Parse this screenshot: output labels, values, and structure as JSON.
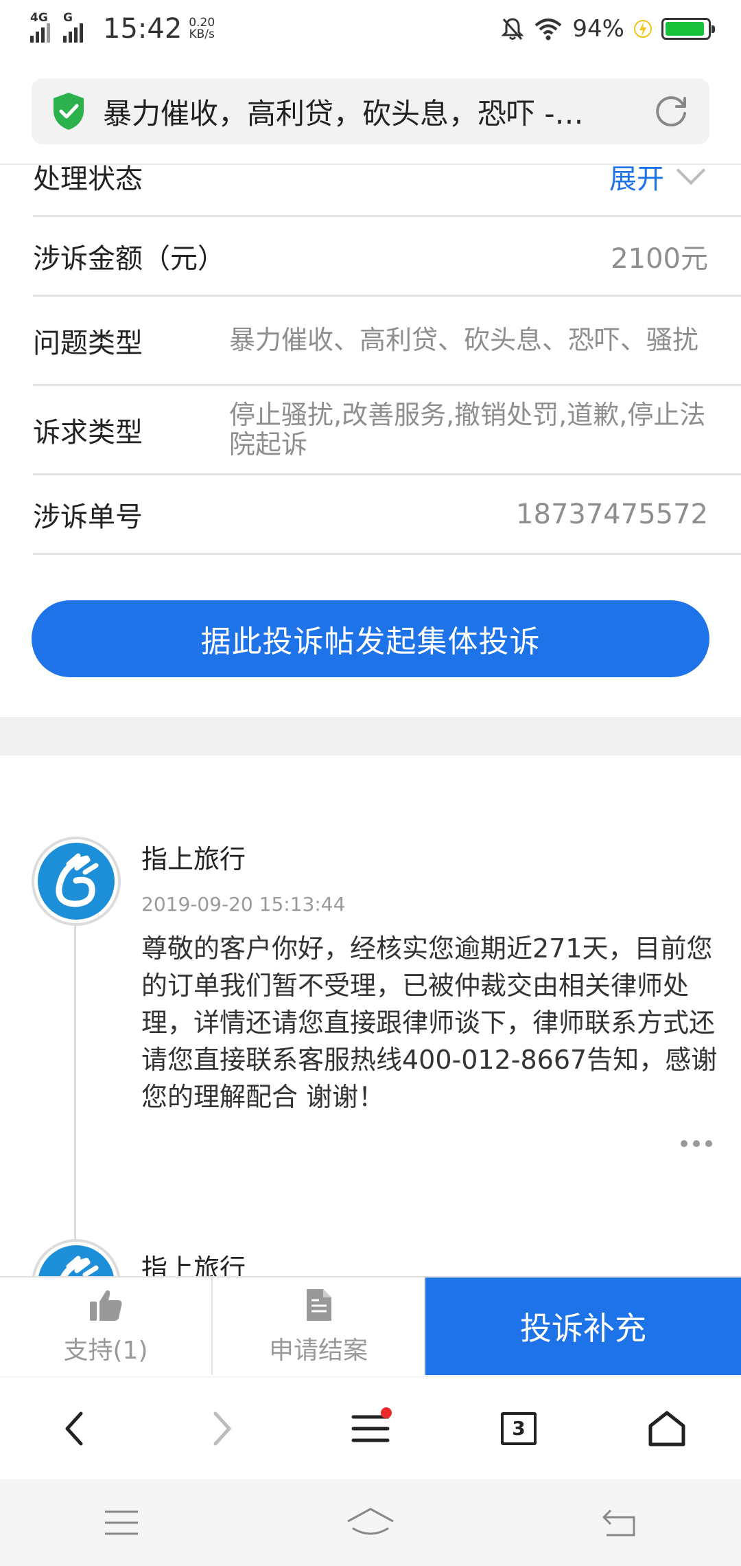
{
  "status_bar": {
    "network_1": "4G",
    "network_2": "G",
    "time": "15:42",
    "speed_value": "0.20",
    "speed_unit": "KB/s",
    "battery_percent": "94%",
    "battery_level": 0.94,
    "battery_color": "#19c23a"
  },
  "address_bar": {
    "title": "暴力催收，高利贷，砍头息，恐吓 -…",
    "secure_icon_color": "#2bb24c"
  },
  "details": {
    "status_label": "处理状态",
    "expand_label": "展开",
    "amount_label": "涉诉金额（元）",
    "amount_value": "2100元",
    "issue_type_label": "问题类型",
    "issue_type_value": "暴力催收、高利贷、砍头息、恐吓、骚扰",
    "demand_type_label": "诉求类型",
    "demand_type_value": "停止骚扰,改善服务,撤销处罚,道歉,停止法院起诉",
    "case_no_label": "涉诉单号",
    "case_no_value": "18737475572"
  },
  "collective_button": "据此投诉帖发起集体投诉",
  "comments": [
    {
      "author": "指上旅行",
      "date": "2019-09-20 15:13:44",
      "text": "尊敬的客户你好，经核实您逾期近271天，目前您的订单我们暂不受理，已被仲裁交由相关律师处理，详情还请您直接跟律师谈下，律师联系方式还请您直接联系客服热线400-012-8667告知，感谢您的理解配合 谢谢！"
    },
    {
      "author": "指上旅行"
    }
  ],
  "action_bar": {
    "support_label": "支持(1)",
    "close_case_label": "申请结案",
    "supplement_label": "投诉补充"
  },
  "browser_bar": {
    "tab_count": "3"
  },
  "colors": {
    "accent": "#1e73e8",
    "muted_text": "#8e8e8e",
    "notification_dot": "#ee2b2b"
  }
}
